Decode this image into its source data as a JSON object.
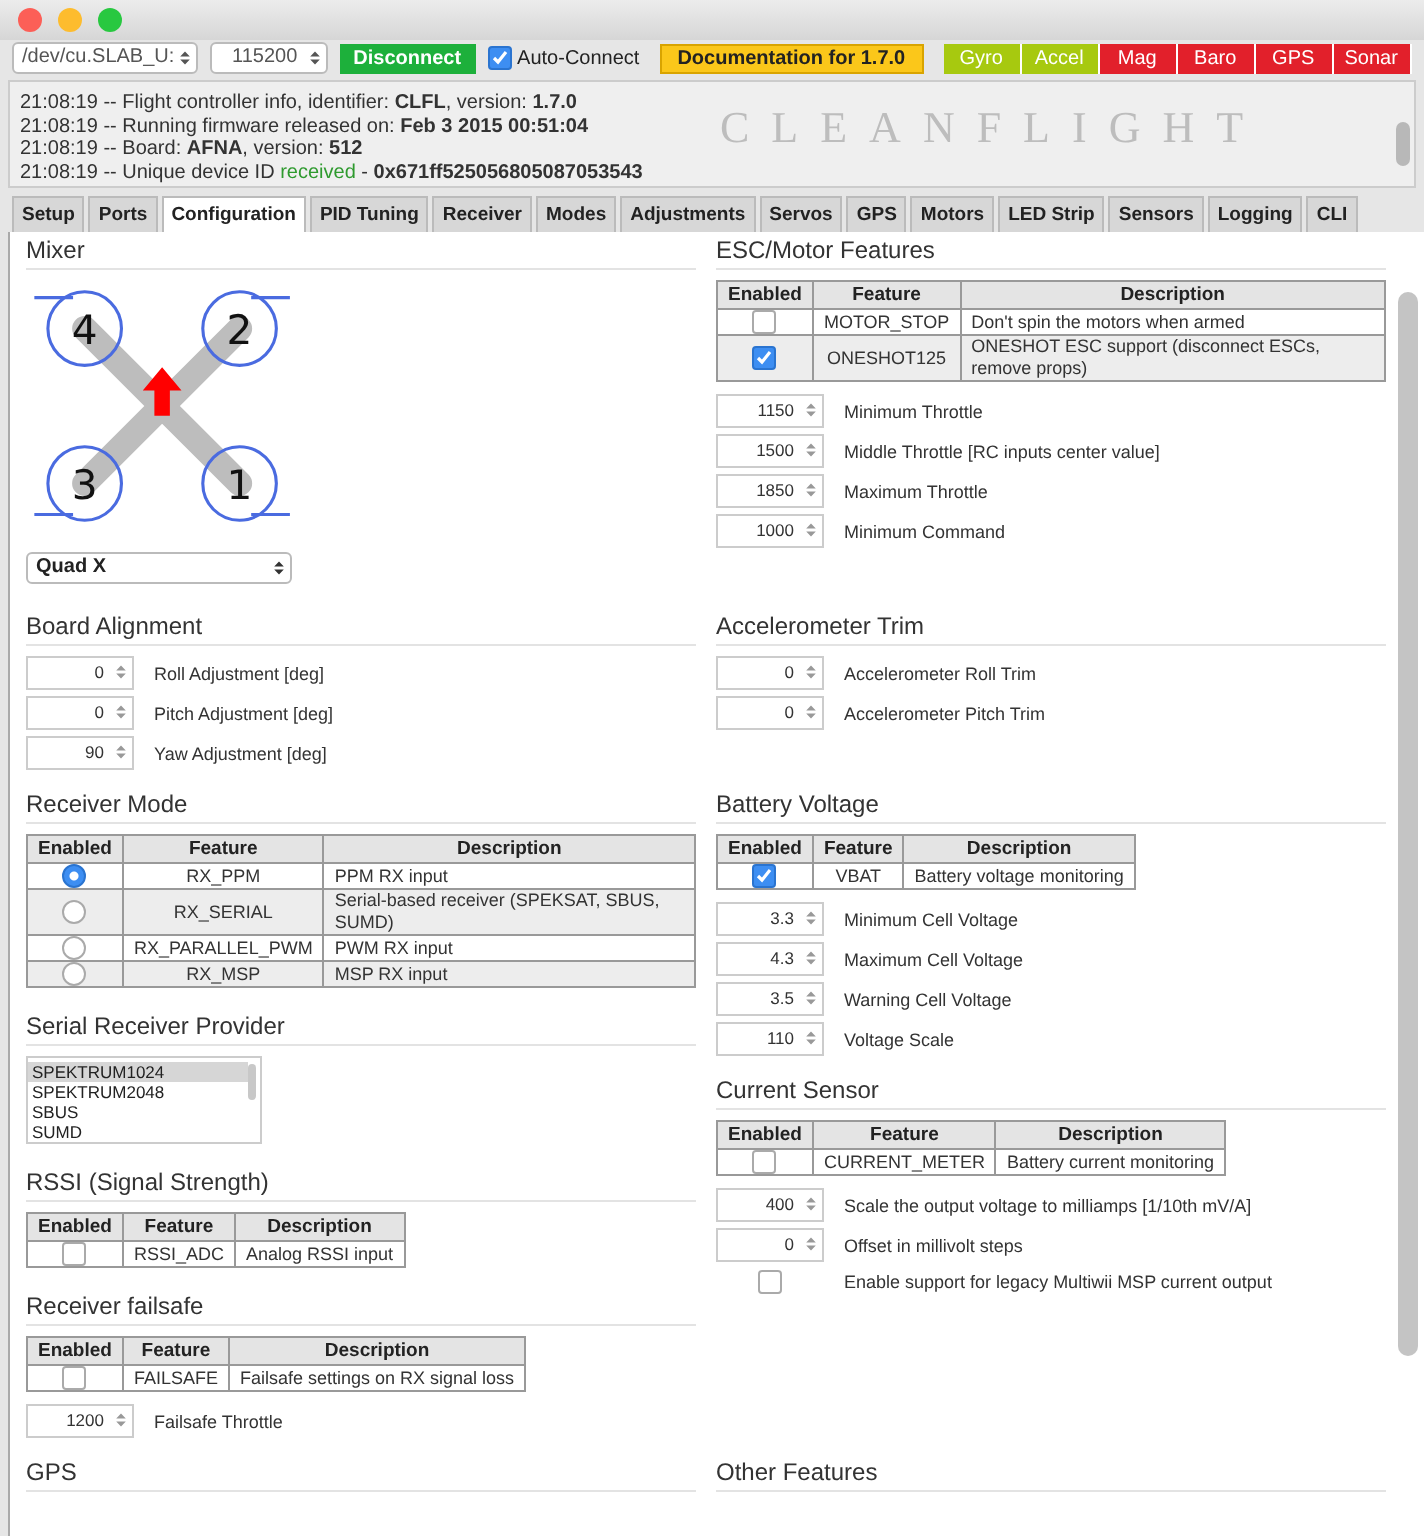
{
  "toolbar": {
    "port": "/dev/cu.SLAB_U:",
    "baud": "115200",
    "connect_button": "Disconnect",
    "auto_connect": {
      "label": "Auto-Connect",
      "checked": true
    },
    "documentation": "Documentation for 1.7.0",
    "sensors": [
      {
        "label": "Gyro",
        "on": true
      },
      {
        "label": "Accel",
        "on": true
      },
      {
        "label": "Mag",
        "on": false
      },
      {
        "label": "Baro",
        "on": false
      },
      {
        "label": "GPS",
        "on": false
      },
      {
        "label": "Sonar",
        "on": false
      }
    ]
  },
  "log": {
    "lines": [
      {
        "text": "21:08:19 -- Flight controller info, identifier: **CLFL**, version: **1.7.0**"
      },
      {
        "text": "21:08:19 -- Running firmware released on: **Feb 3 2015 00:51:04**"
      },
      {
        "text": "21:08:19 -- Board: **AFNA**, version: **512**"
      },
      {
        "text": "21:08:19 -- Unique device ID ",
        "status": "received",
        "rest": " - **0x671ff525056805087053543**"
      }
    ],
    "logo": "CLEANFLIGHT"
  },
  "tabs": [
    {
      "label": "Setup",
      "selected": false
    },
    {
      "label": "Ports",
      "selected": false
    },
    {
      "label": "Configuration",
      "selected": true
    },
    {
      "label": "PID Tuning",
      "selected": false
    },
    {
      "label": "Receiver",
      "selected": false
    },
    {
      "label": "Modes",
      "selected": false
    },
    {
      "label": "Adjustments",
      "selected": false
    },
    {
      "label": "Servos",
      "selected": false
    },
    {
      "label": "GPS",
      "selected": false
    },
    {
      "label": "Motors",
      "selected": false
    },
    {
      "label": "LED Strip",
      "selected": false
    },
    {
      "label": "Sensors",
      "selected": false
    },
    {
      "label": "Logging",
      "selected": false
    },
    {
      "label": "CLI",
      "selected": false
    }
  ],
  "rows": [
    {
      "left": [
        {
          "title": "Mixer",
          "mixer": {
            "motor_labels": [
              "4",
              "2",
              "3",
              "1"
            ]
          },
          "select": "Quad X"
        }
      ],
      "right": [
        {
          "title": "ESC/Motor Features",
          "table": {
            "kind": "checkbox",
            "columns": [
              "Enabled",
              "Feature",
              "Description"
            ],
            "rows": [
              {
                "checked": false,
                "feature": "MOTOR_STOP",
                "description": "Don't spin the motors when armed"
              },
              {
                "checked": true,
                "feature": "ONESHOT125",
                "description": "ONESHOT ESC support (disconnect ESCs, remove props)"
              }
            ]
          },
          "fields": [
            {
              "value": "1150",
              "label": "Minimum Throttle"
            },
            {
              "value": "1500",
              "label": "Middle Throttle [RC inputs center value]"
            },
            {
              "value": "1850",
              "label": "Maximum Throttle"
            },
            {
              "value": "1000",
              "label": "Minimum Command"
            }
          ]
        }
      ]
    },
    {
      "left": [
        {
          "title": "Board Alignment",
          "fields": [
            {
              "value": "0",
              "label": "Roll Adjustment [deg]"
            },
            {
              "value": "0",
              "label": "Pitch Adjustment [deg]"
            },
            {
              "value": "90",
              "label": "Yaw Adjustment [deg]"
            }
          ]
        }
      ],
      "right": [
        {
          "title": "Accelerometer Trim",
          "fields": [
            {
              "value": "0",
              "label": "Accelerometer Roll Trim"
            },
            {
              "value": "0",
              "label": "Accelerometer Pitch Trim"
            }
          ]
        }
      ]
    },
    {
      "left": [
        {
          "title": "Receiver Mode",
          "table": {
            "kind": "radio",
            "columns": [
              "Enabled",
              "Feature",
              "Description"
            ],
            "rows": [
              {
                "selected": true,
                "feature": "RX_PPM",
                "description": "PPM RX input"
              },
              {
                "selected": false,
                "feature": "RX_SERIAL",
                "description": "Serial-based receiver (SPEKSAT, SBUS, SUMD)"
              },
              {
                "selected": false,
                "feature": "RX_PARALLEL_PWM",
                "description": "PWM RX input"
              },
              {
                "selected": false,
                "feature": "RX_MSP",
                "description": "MSP RX input"
              }
            ]
          }
        },
        {
          "title": "Serial Receiver Provider",
          "listbox": [
            {
              "label": "SPEKTRUM1024",
              "selected": true
            },
            {
              "label": "SPEKTRUM2048",
              "selected": false
            },
            {
              "label": "SBUS",
              "selected": false
            },
            {
              "label": "SUMD",
              "selected": false
            }
          ]
        },
        {
          "title": "RSSI (Signal Strength)",
          "table": {
            "kind": "checkbox",
            "columns": [
              "Enabled",
              "Feature",
              "Description"
            ],
            "rows": [
              {
                "checked": false,
                "feature": "RSSI_ADC",
                "description": "Analog RSSI input"
              }
            ]
          }
        },
        {
          "title": "Receiver failsafe",
          "table": {
            "kind": "checkbox",
            "columns": [
              "Enabled",
              "Feature",
              "Description"
            ],
            "rows": [
              {
                "checked": false,
                "feature": "FAILSAFE",
                "description": "Failsafe settings on RX signal loss"
              }
            ]
          },
          "fields": [
            {
              "value": "1200",
              "label": "Failsafe Throttle"
            }
          ]
        }
      ],
      "right": [
        {
          "title": "Battery Voltage",
          "table": {
            "kind": "checkbox",
            "columns": [
              "Enabled",
              "Feature",
              "Description"
            ],
            "rows": [
              {
                "checked": true,
                "feature": "VBAT",
                "description": "Battery voltage monitoring"
              }
            ]
          },
          "fields": [
            {
              "value": "3.3",
              "label": "Minimum Cell Voltage"
            },
            {
              "value": "4.3",
              "label": "Maximum Cell Voltage"
            },
            {
              "value": "3.5",
              "label": "Warning Cell Voltage"
            },
            {
              "value": "110",
              "label": "Voltage Scale"
            }
          ]
        },
        {
          "title": "Current Sensor",
          "table": {
            "kind": "checkbox",
            "columns": [
              "Enabled",
              "Feature",
              "Description"
            ],
            "rows": [
              {
                "checked": false,
                "feature": "CURRENT_METER",
                "description": "Battery current monitoring"
              }
            ]
          },
          "fields": [
            {
              "value": "400",
              "label": "Scale the output voltage to milliamps [1/10th mV/A]"
            },
            {
              "value": "0",
              "label": "Offset in millivolt steps"
            }
          ],
          "options": [
            {
              "checked": false,
              "label": "Enable support for legacy Multiwii MSP current output"
            }
          ]
        }
      ]
    },
    {
      "left": [
        {
          "title": "GPS"
        }
      ],
      "right": [
        {
          "title": "Other Features"
        }
      ]
    }
  ]
}
